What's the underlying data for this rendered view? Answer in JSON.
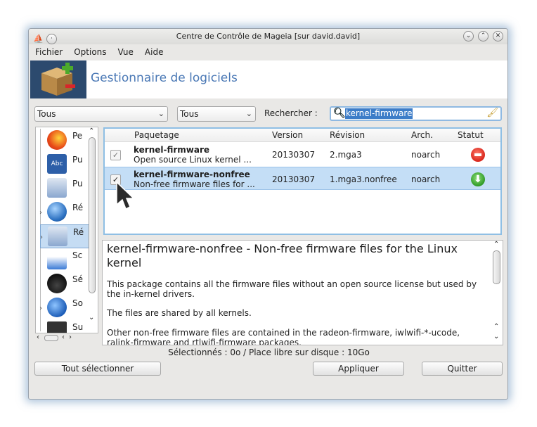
{
  "window": {
    "title": "Centre de Contrôle de Mageia  [sur david.david]"
  },
  "menu": {
    "file": "Fichier",
    "options": "Options",
    "view": "Vue",
    "help": "Aide"
  },
  "banner": {
    "title": "Gestionnaire de logiciels",
    "icon": "package-box-icon"
  },
  "filters": {
    "type_value": "Tous",
    "status_value": "Tous",
    "search_label": "Rechercher :",
    "search_value": "kernel-firmware"
  },
  "categories": [
    {
      "label": "Pe",
      "icon": "firefox-icon"
    },
    {
      "label": "Pu",
      "icon": "abc-book-icon"
    },
    {
      "label": "Pu",
      "icon": "network-computer-icon"
    },
    {
      "label": "Ré",
      "icon": "globe-icon"
    },
    {
      "label": "Ré",
      "icon": "network-computer-icon"
    },
    {
      "label": "Sc",
      "icon": "flask-icon"
    },
    {
      "label": "Sé",
      "icon": "police-icon"
    },
    {
      "label": "So",
      "icon": "speaker-icon"
    },
    {
      "label": "Su",
      "icon": "monitor-icon"
    }
  ],
  "table": {
    "headers": {
      "package": "Paquetage",
      "version": "Version",
      "revision": "Révision",
      "arch": "Arch.",
      "status": "Statut"
    },
    "rows": [
      {
        "name": "kernel-firmware",
        "summary": "Open source Linux kernel ...",
        "version": "20130307",
        "revision": "2.mga3",
        "arch": "noarch",
        "status_icon": "installed-remove-icon",
        "checked": true
      },
      {
        "name": "kernel-firmware-nonfree",
        "summary": "Non-free firmware files for ...",
        "version": "20130307",
        "revision": "1.mga3.nonfree",
        "arch": "noarch",
        "status_icon": "install-download-icon",
        "checked": true
      }
    ]
  },
  "description": {
    "title": "kernel-firmware-nonfree - Non-free firmware files for the Linux kernel",
    "p1": "This package contains all the firmware files without an open source license but used by the in-kernel drivers.",
    "p2": "The files are shared by all kernels.",
    "p3": "Other non-free firmware files are contained in the radeon-firmware, iwlwifi-*-ucode, ralink-firmware and rtlwifi-firmware packages."
  },
  "status_bar": "Sélectionnés : 0o / Place libre sur disque : 10Go",
  "buttons": {
    "select_all": "Tout sélectionner",
    "apply": "Appliquer",
    "quit": "Quitter"
  },
  "colors": {
    "accent": "#4a78b5",
    "selection": "#c4def6",
    "remove": "#e23a2a",
    "install": "#3aa83a"
  }
}
